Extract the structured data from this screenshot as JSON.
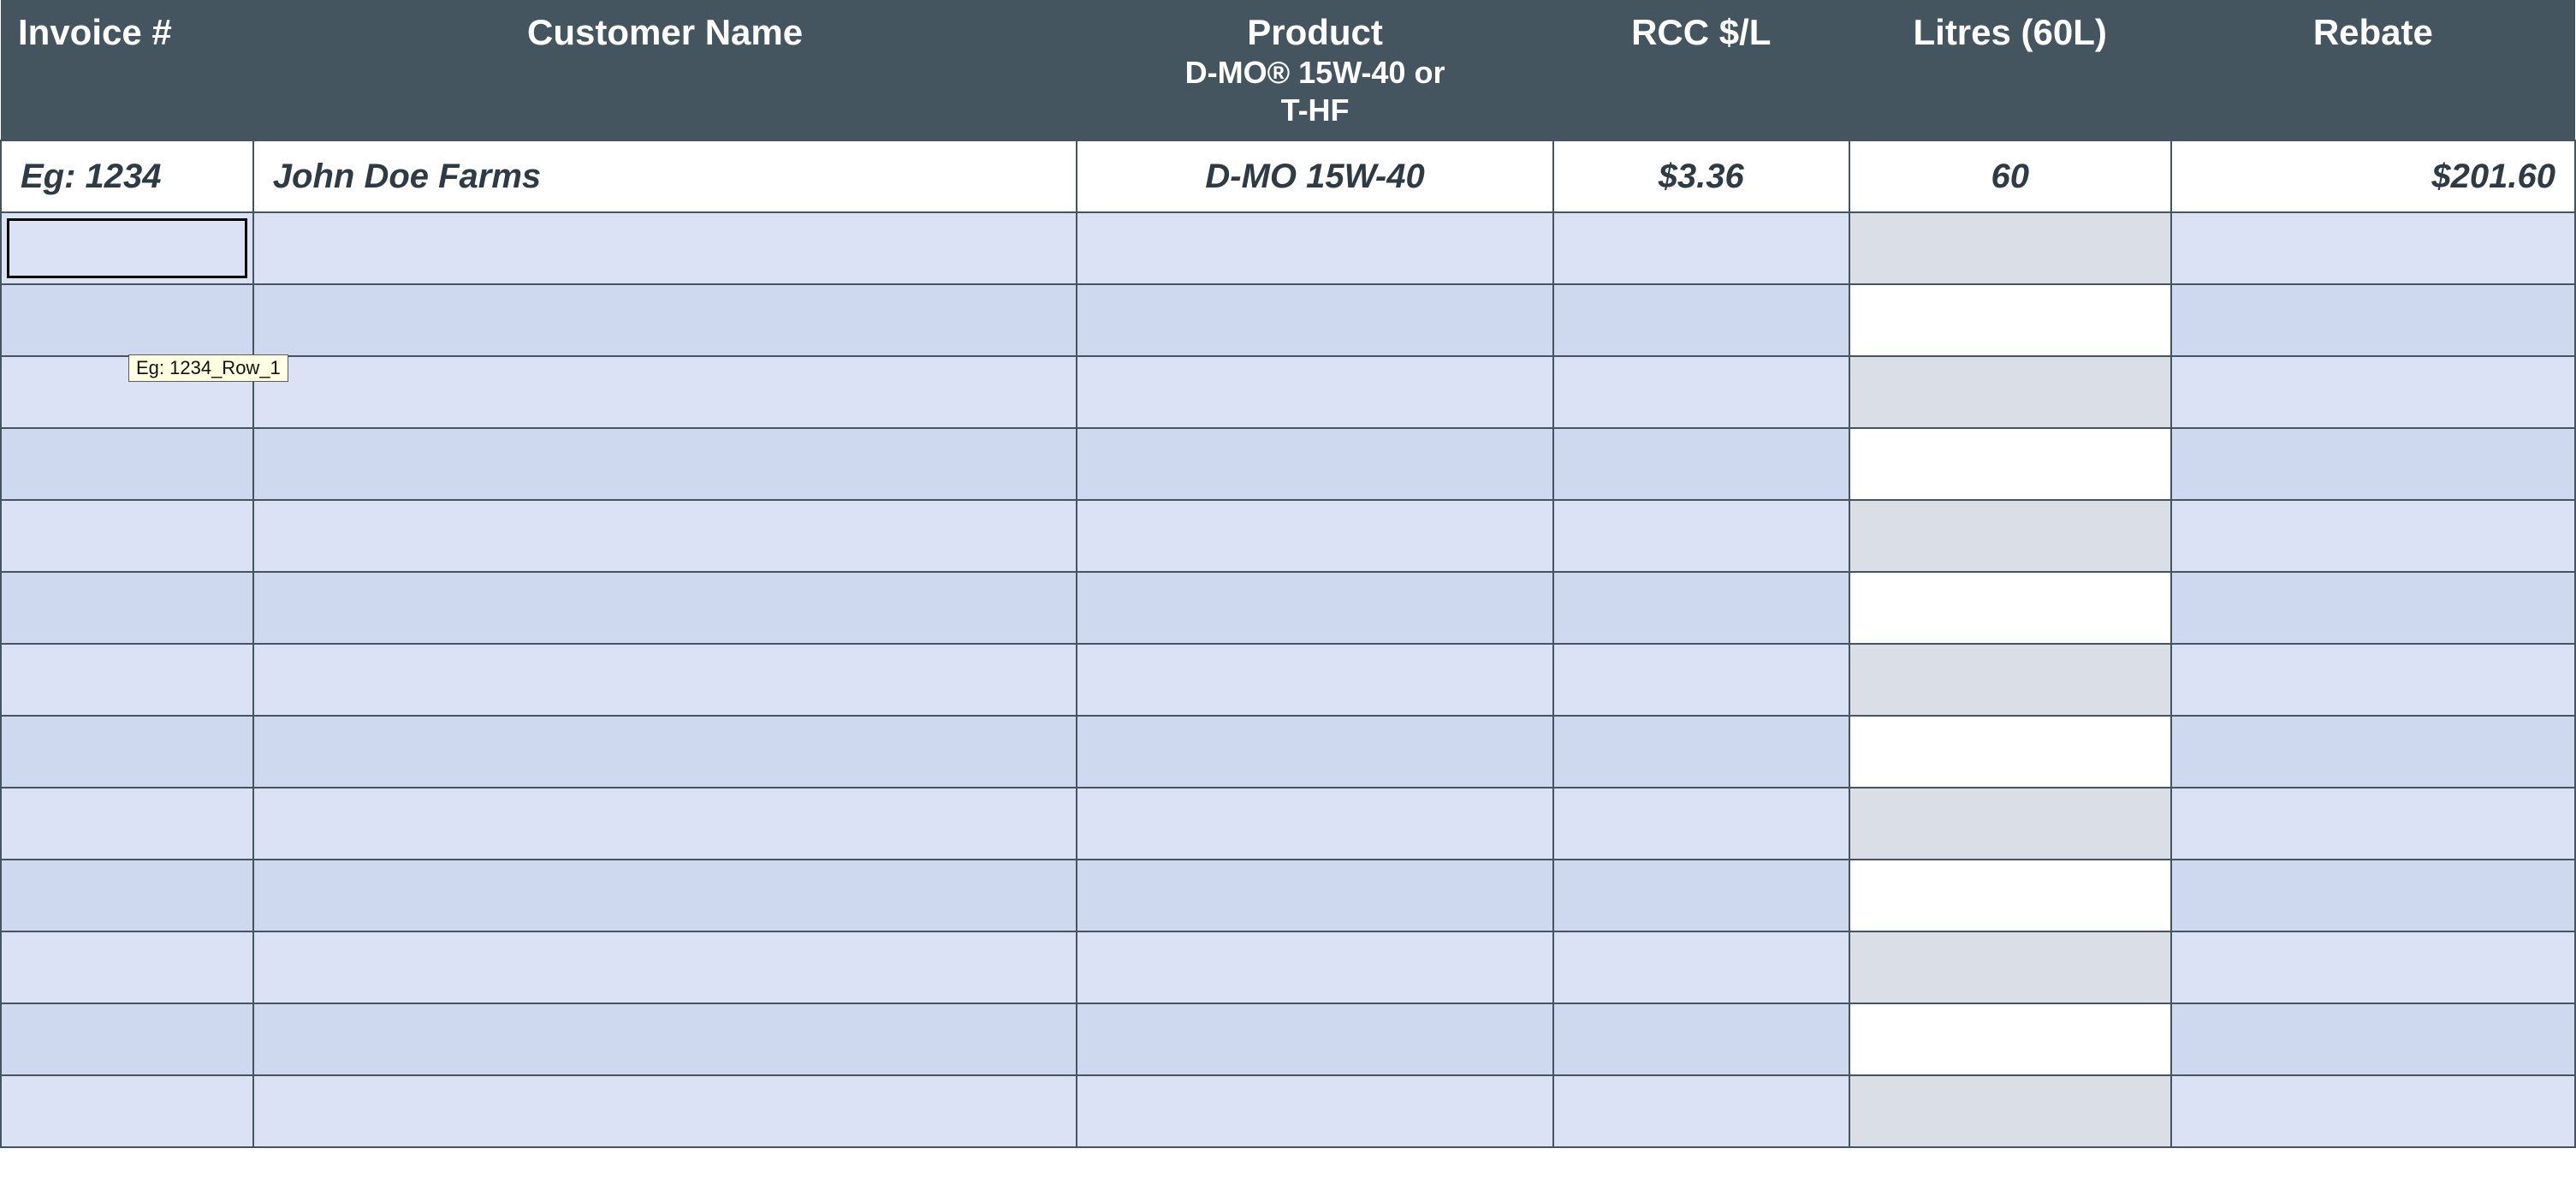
{
  "headers": {
    "invoice": "Invoice #",
    "customer": "Customer Name",
    "product": "Product",
    "product_sub1": "D-MO® 15W-40 or",
    "product_sub2": "T-HF",
    "rcc": "RCC $/L",
    "litres": "Litres (60L)",
    "rebate": "Rebate"
  },
  "example": {
    "invoice": "Eg: 1234",
    "customer": "John Doe Farms",
    "product": "D-MO 15W-40",
    "rcc": "$3.36",
    "litres": "60",
    "rebate": "$201.60"
  },
  "tooltip": "Eg: 1234_Row_1",
  "row_count": 13
}
